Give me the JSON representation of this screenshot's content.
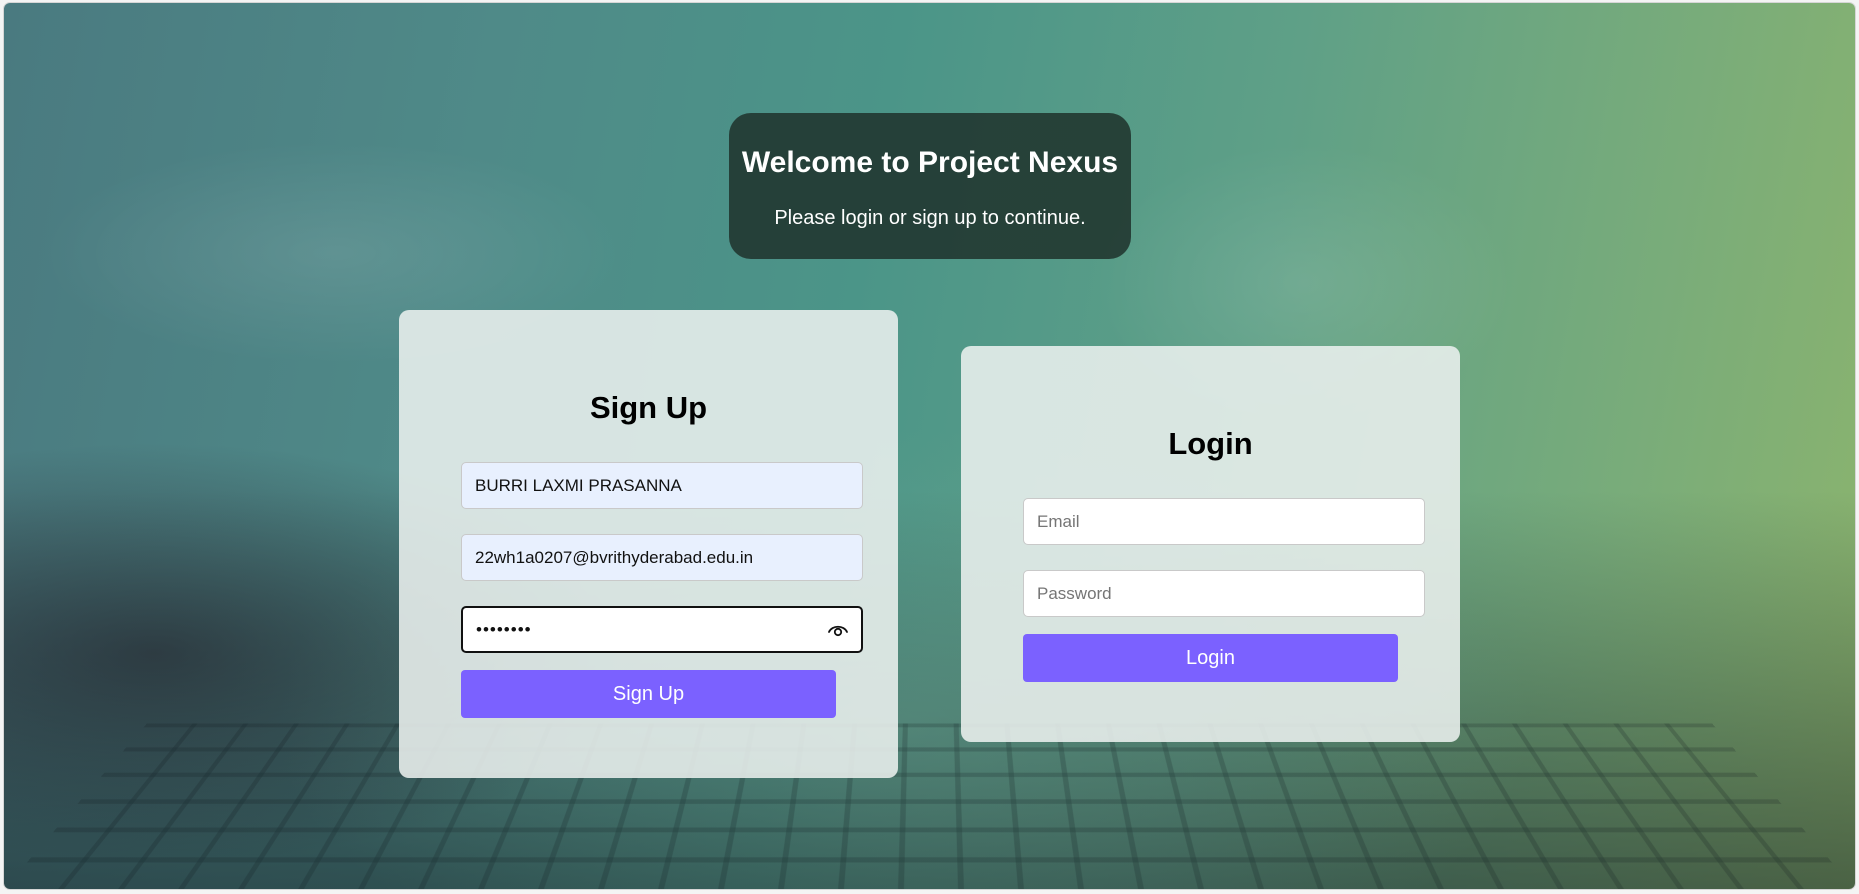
{
  "welcome": {
    "title": "Welcome to Project Nexus",
    "subtitle": "Please login or sign up to continue."
  },
  "signup": {
    "heading": "Sign Up",
    "name_value": "BURRI LAXMI PRASANNA",
    "email_value": "22wh1a0207@bvrithyderabad.edu.in",
    "password_value": "••••••••",
    "password_toggle_icon": "eye-icon",
    "button_label": "Sign Up"
  },
  "login": {
    "heading": "Login",
    "email_placeholder": "Email",
    "password_placeholder": "Password",
    "button_label": "Login"
  },
  "colors": {
    "accent": "#7b61ff",
    "welcome_bg": "#20342e",
    "card_bg": "#ebf0ee"
  }
}
